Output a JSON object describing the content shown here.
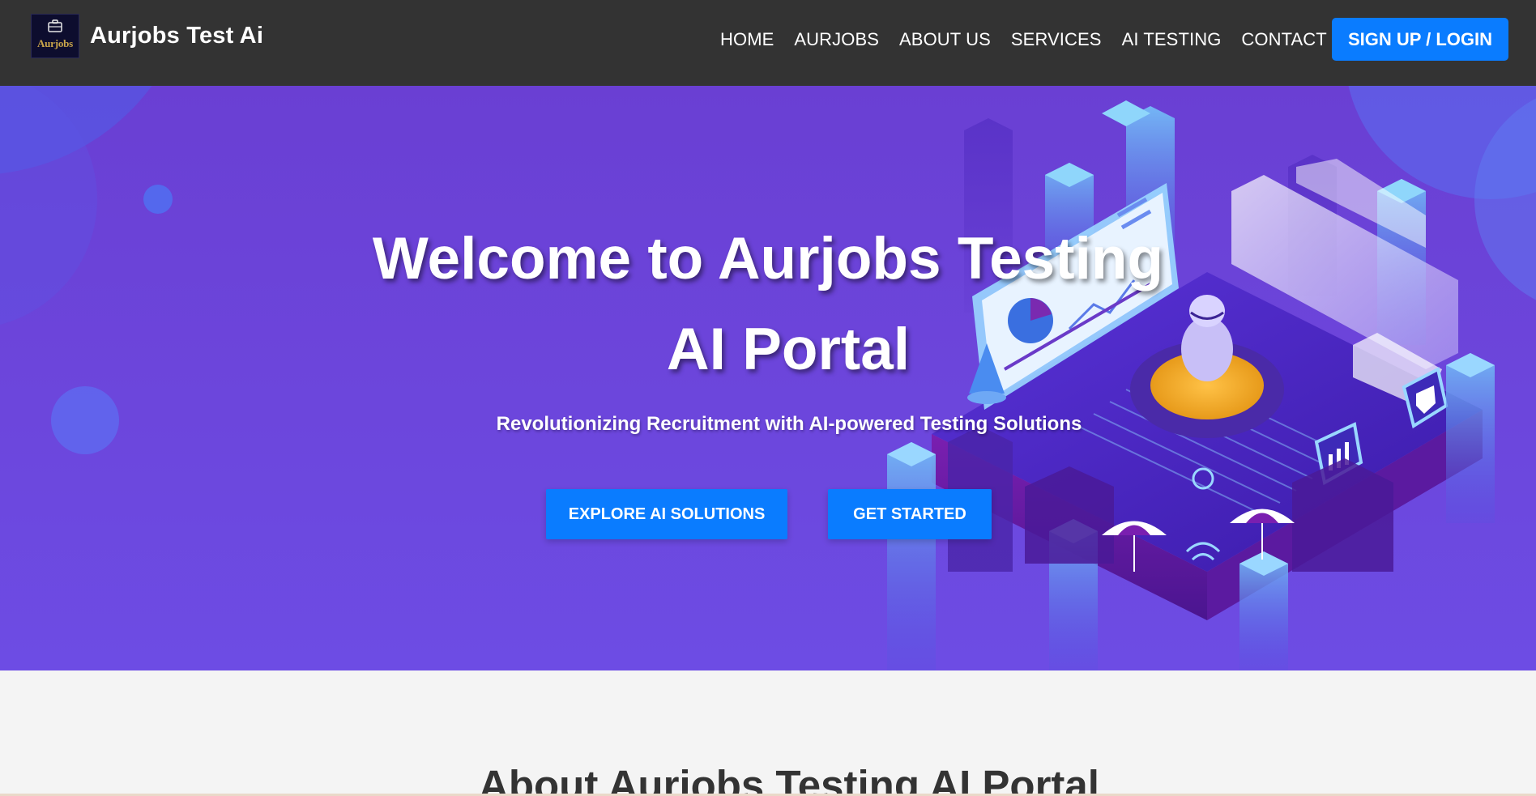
{
  "navbar": {
    "logo_text": "Aurjobs",
    "brand": "Aurjobs Test Ai",
    "links": [
      {
        "label": "HOME"
      },
      {
        "label": "AURJOBS"
      },
      {
        "label": "ABOUT US"
      },
      {
        "label": "SERVICES"
      },
      {
        "label": "AI TESTING"
      },
      {
        "label": "CONTACT US"
      }
    ],
    "signup_label": "SIGN UP / LOGIN"
  },
  "hero": {
    "title_line1": "Welcome to Aurjobs Testing",
    "title_line2": "AI Portal",
    "subtitle": "Revolutionizing Recruitment with AI-powered Testing Solutions",
    "buttons": {
      "explore": "EXPLORE AI SOLUTIONS",
      "start": "GET STARTED"
    }
  },
  "about": {
    "heading": "About Aurjobs Testing AI Portal"
  },
  "colors": {
    "navbar_bg": "#333333",
    "accent": "#0a7cff",
    "hero_bg": "#6c46dc",
    "page_bg": "#f4f4f4"
  }
}
